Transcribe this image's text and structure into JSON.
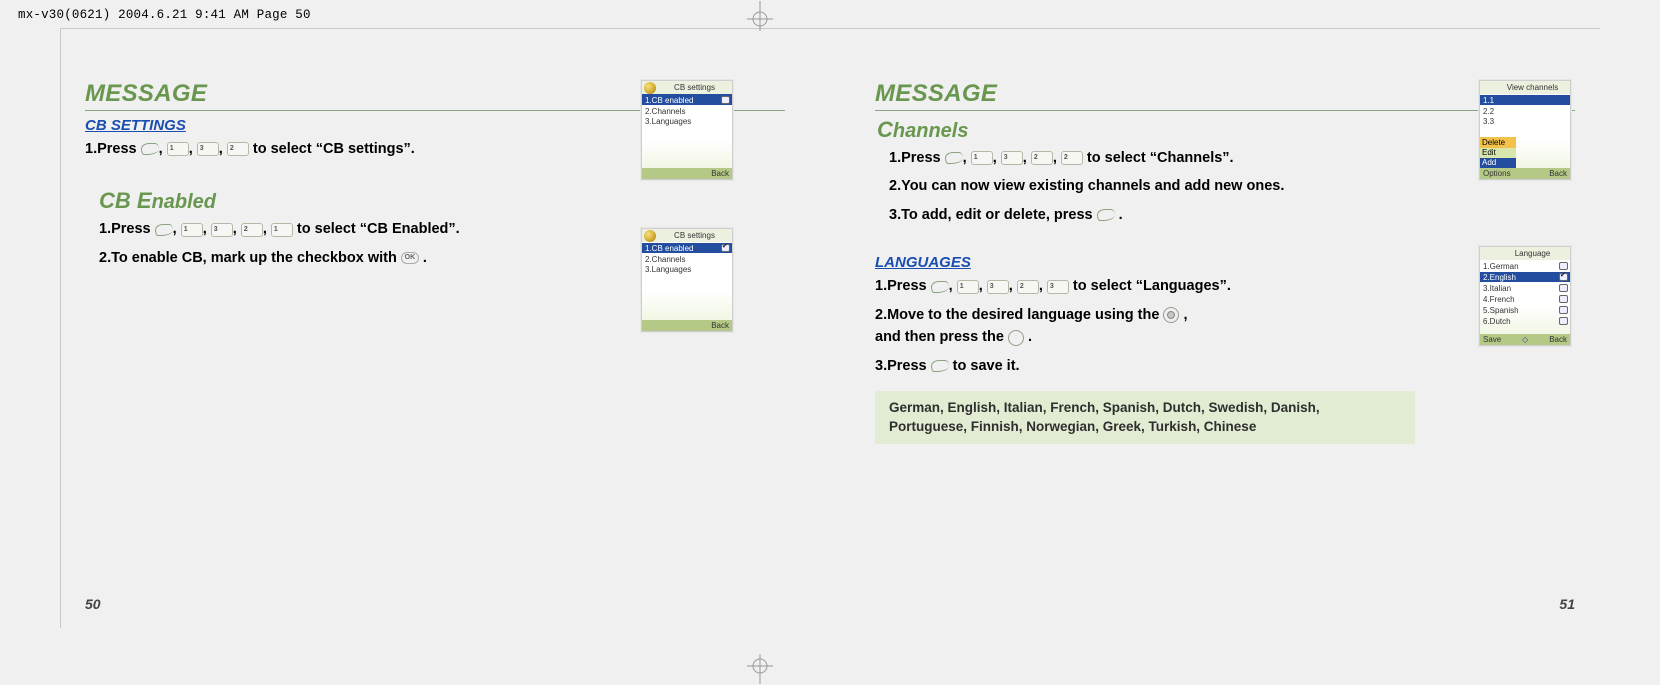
{
  "print_header": "mx-v30(0621)  2004.6.21  9:41 AM  Page 50",
  "left": {
    "title": "MESSAGE",
    "section1_heading": "CB SETTINGS",
    "section1_step1_prefix": "1.Press ",
    "section1_step1_suffix": " to select “CB settings”.",
    "phone1": {
      "title": "CB settings",
      "items": [
        "1.CB enabled",
        "2.Channels",
        "3.Languages"
      ],
      "soft_right": "Back"
    },
    "section2_heading_cap": "CB E",
    "section2_heading_rest": "nabled",
    "section2_step1_prefix": "1.Press  ",
    "section2_step1_suffix": " to select “CB Enabled”.",
    "section2_step2": "2.To enable CB, mark up the checkbox with ",
    "section2_step2_tail": ".",
    "phone2": {
      "title": "CB settings",
      "items": [
        "1.CB enabled",
        "2.Channels",
        "3.Languages"
      ],
      "soft_right": "Back"
    },
    "page_number": "50"
  },
  "right": {
    "title": "MESSAGE",
    "section1_heading_cap": "C",
    "section1_heading_rest": "hannels",
    "section1_step1_prefix": "1.Press  ",
    "section1_step1_suffix": " to select “Channels”.",
    "section1_step2": "2.You can now view existing channels and add new ones.",
    "section1_step3_prefix": "3.To add, edit or delete, press ",
    "section1_step3_suffix": " .",
    "phone3": {
      "title": "View channels",
      "items": [
        "1.1",
        "2.2",
        "3.3"
      ],
      "popup": [
        "Delete",
        "Edit",
        "Add"
      ],
      "soft_left": "Options",
      "soft_right": "Back"
    },
    "section2_heading": "LANGUAGES",
    "section2_step1_prefix": "1.Press ",
    "section2_step1_suffix": " to select “Languages”.",
    "section2_step2a": "2.Move to the desired language using the ",
    "section2_step2b": ",",
    "section2_step2c": "  and then press the ",
    "section2_step2d": " .",
    "section2_step3_prefix": "3.Press ",
    "section2_step3_suffix": " to save it.",
    "note": "German, English, Italian, French, Spanish, Dutch, Swedish, Danish, Portuguese, Finnish, Norwegian, Greek, Turkish, Chinese",
    "phone4": {
      "title": "Language",
      "items": [
        "1.German",
        "2.English",
        "3.Italian",
        "4.French",
        "5.Spanish",
        "6.Dutch"
      ],
      "soft_left": "Save",
      "soft_right": "Back"
    },
    "page_number": "51"
  },
  "keys": {
    "one": "1",
    "two": "2",
    "three": "3"
  }
}
